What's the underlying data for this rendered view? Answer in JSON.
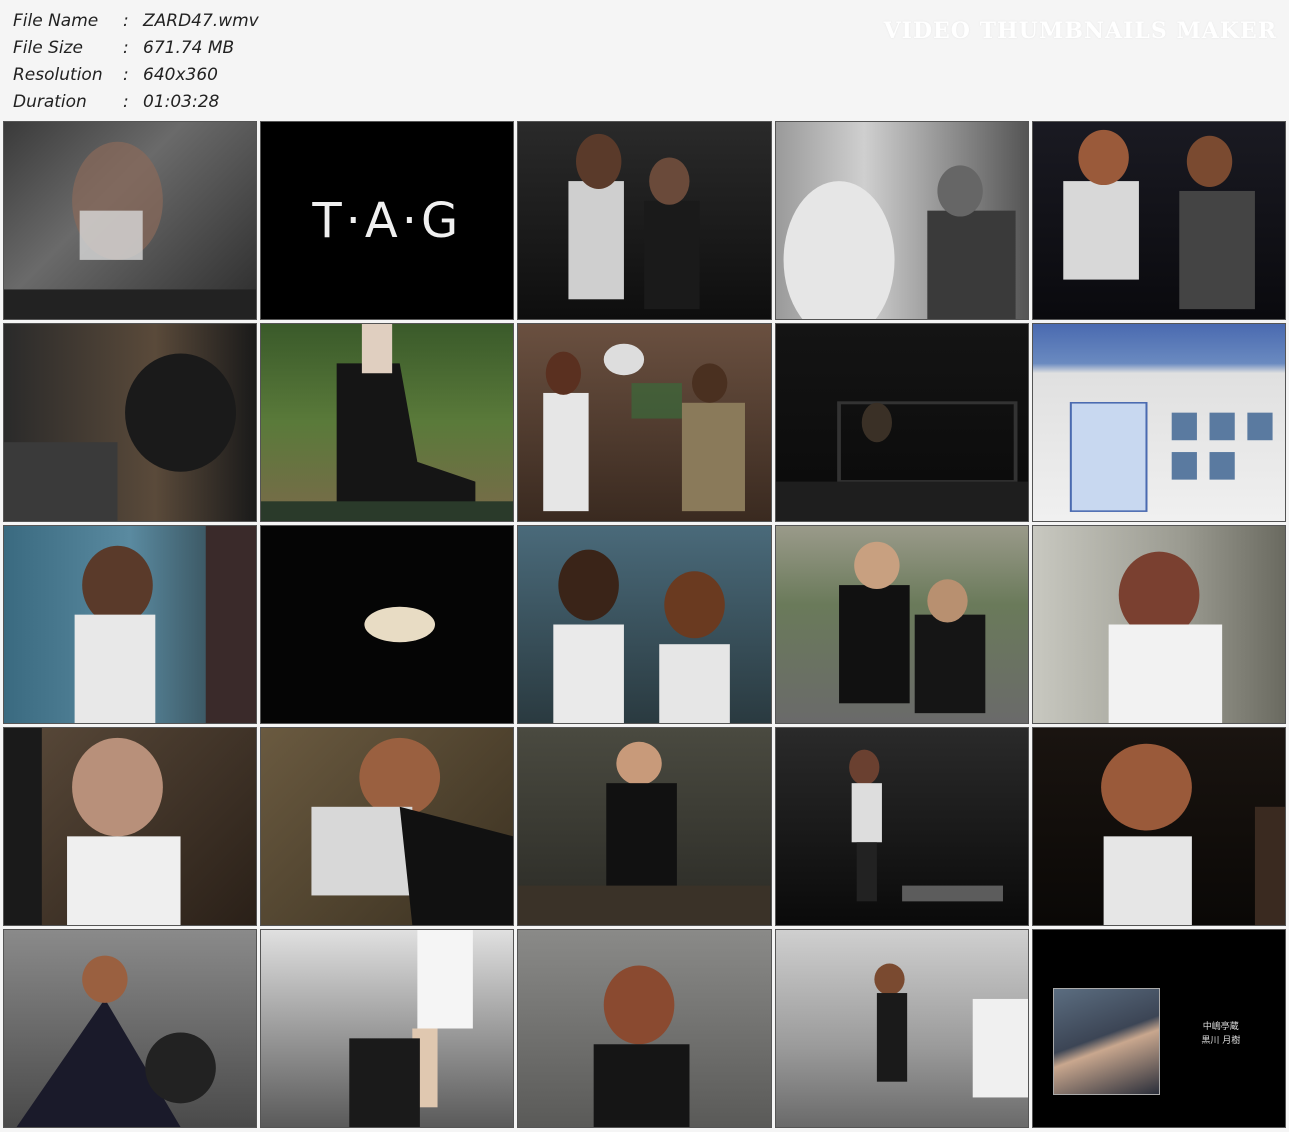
{
  "info": {
    "rows": [
      {
        "label": "File Name",
        "value": "ZARD47.wmv"
      },
      {
        "label": "File Size",
        "value": "671.74 MB"
      },
      {
        "label": "Resolution",
        "value": "640x360"
      },
      {
        "label": "Duration",
        "value": "01:03:28"
      }
    ],
    "colon": ":"
  },
  "watermark": "VIDEO THUMBNAILS MAKER",
  "logo_text": "T·A·G",
  "credit": {
    "line1": "中嶋亭蔵",
    "line2": "黒川 月樹"
  },
  "colors": {
    "background": "#f5f5f5",
    "text": "#222222",
    "thumb_border": "#555555"
  }
}
